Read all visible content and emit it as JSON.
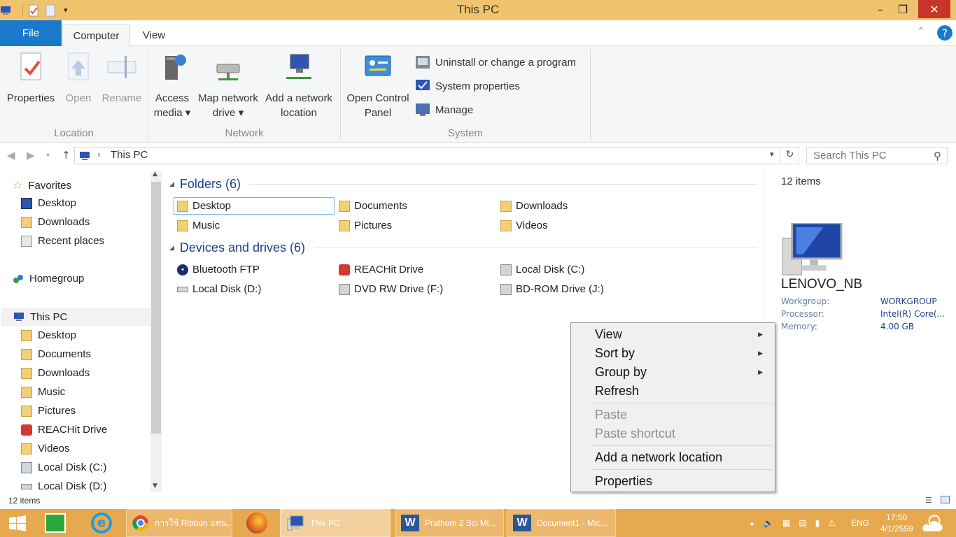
{
  "window": {
    "title": "This PC"
  },
  "tabs": {
    "file": "File",
    "computer": "Computer",
    "view": "View"
  },
  "ribbon": {
    "properties": "Properties",
    "open": "Open",
    "rename": "Rename",
    "access_media_1": "Access",
    "access_media_2": "media ▾",
    "map_drive_1": "Map network",
    "map_drive_2": "drive ▾",
    "add_loc_1": "Add a network",
    "add_loc_2": "location",
    "control_1": "Open Control",
    "control_2": "Panel",
    "uninstall": "Uninstall or change a program",
    "sysprops": "System properties",
    "manage": "Manage",
    "group_location": "Location",
    "group_network": "Network",
    "group_system": "System"
  },
  "address": {
    "path": "This PC",
    "search_placeholder": "Search This PC"
  },
  "nav": {
    "favorites": "Favorites",
    "fav_items": [
      "Desktop",
      "Downloads",
      "Recent places"
    ],
    "homegroup": "Homegroup",
    "thispc": "This PC",
    "pc_items": [
      "Desktop",
      "Documents",
      "Downloads",
      "Music",
      "Pictures",
      "REACHit Drive",
      "Videos",
      "Local Disk (C:)",
      "Local Disk (D:)"
    ]
  },
  "content": {
    "folders_header": "Folders (6)",
    "folders": [
      "Desktop",
      "Documents",
      "Downloads",
      "Music",
      "Pictures",
      "Videos"
    ],
    "devices_header": "Devices and drives (6)",
    "devices": [
      "Bluetooth FTP",
      "REACHit Drive",
      "Local Disk (C:)",
      "Local Disk (D:)",
      "DVD RW Drive (F:)",
      "BD-ROM Drive (J:)"
    ]
  },
  "details": {
    "count": "12 items",
    "computer_name": "LENOVO_NB",
    "rows": [
      {
        "label": "Workgroup:",
        "value": "WORKGROUP"
      },
      {
        "label": "Processor:",
        "value": "Intel(R) Core(..."
      },
      {
        "label": "Memory:",
        "value": "4.00 GB"
      }
    ]
  },
  "context_menu": {
    "view": "View",
    "sort_by": "Sort by",
    "group_by": "Group by",
    "refresh": "Refresh",
    "paste": "Paste",
    "paste_shortcut": "Paste shortcut",
    "add_network_location": "Add a network location",
    "properties": "Properties"
  },
  "status": {
    "items": "12 items"
  },
  "taskbar": {
    "chrome": "การใช้ Ribbon แทน...",
    "explorer": "This PC",
    "word1": "Prathom 2 Sci Mi...",
    "word2": "Document1 - Mic...",
    "lang": "ENG",
    "time": "17:50",
    "date": "4/1/2559"
  },
  "colors": {
    "titlebar": "#f0c46e",
    "file_tab": "#1979ca",
    "taskbar": "#e7a94f",
    "close": "#c7342a",
    "section": "#1e3f8c"
  }
}
